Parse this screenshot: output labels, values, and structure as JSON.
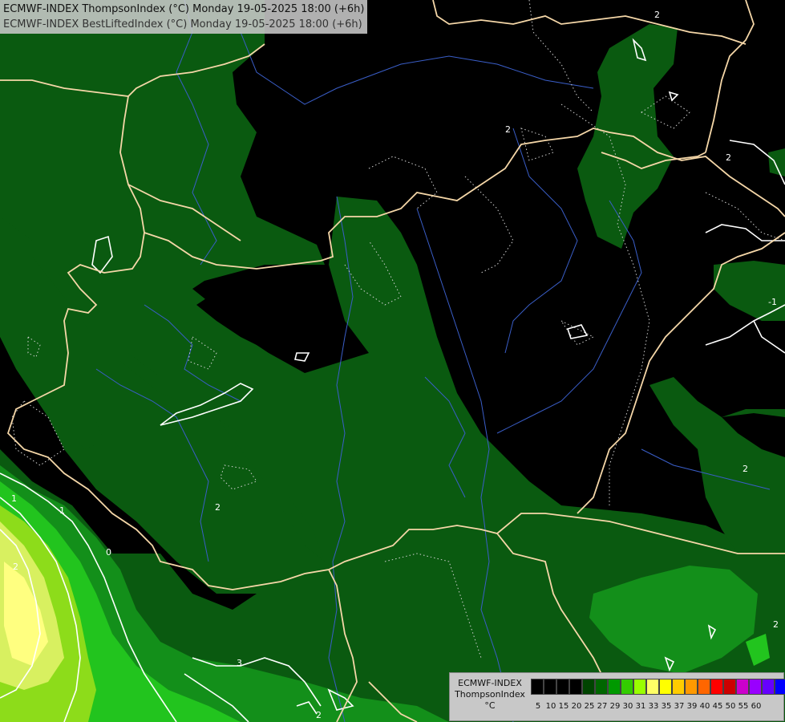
{
  "header": {
    "line1": "ECMWF-INDEX ThompsonIndex (°C) Monday 19-05-2025 18:00 (+6h)",
    "line2": "ECMWF-INDEX BestLiftedIndex (°C) Monday 19-05-2025 18:00 (+6h)"
  },
  "legend": {
    "source": "ECMWF-INDEX",
    "variable": "ThompsonIndex",
    "unit": "°C",
    "ticks": [
      "5",
      "10",
      "15",
      "20",
      "25",
      "27",
      "29",
      "30",
      "31",
      "33",
      "35",
      "37",
      "39",
      "40",
      "45",
      "50",
      "55",
      "60"
    ],
    "colors": [
      "#000000",
      "#000000",
      "#000000",
      "#000000",
      "#004400",
      "#006600",
      "#009900",
      "#33cc00",
      "#99ff00",
      "#ffff66",
      "#ffff00",
      "#ffcc00",
      "#ff9900",
      "#ff6600",
      "#ff0000",
      "#cc0000",
      "#cc00cc",
      "#9900ff",
      "#6600ff",
      "#0000ff"
    ]
  },
  "contour_labels": [
    "2",
    "2",
    "1",
    "0",
    "1",
    "3",
    "2",
    "2",
    "-1",
    "2",
    "2",
    "2",
    "2"
  ],
  "colors": {
    "border": "#f5d7a8",
    "river": "#4a6fd0",
    "contour": "#ffffff"
  }
}
